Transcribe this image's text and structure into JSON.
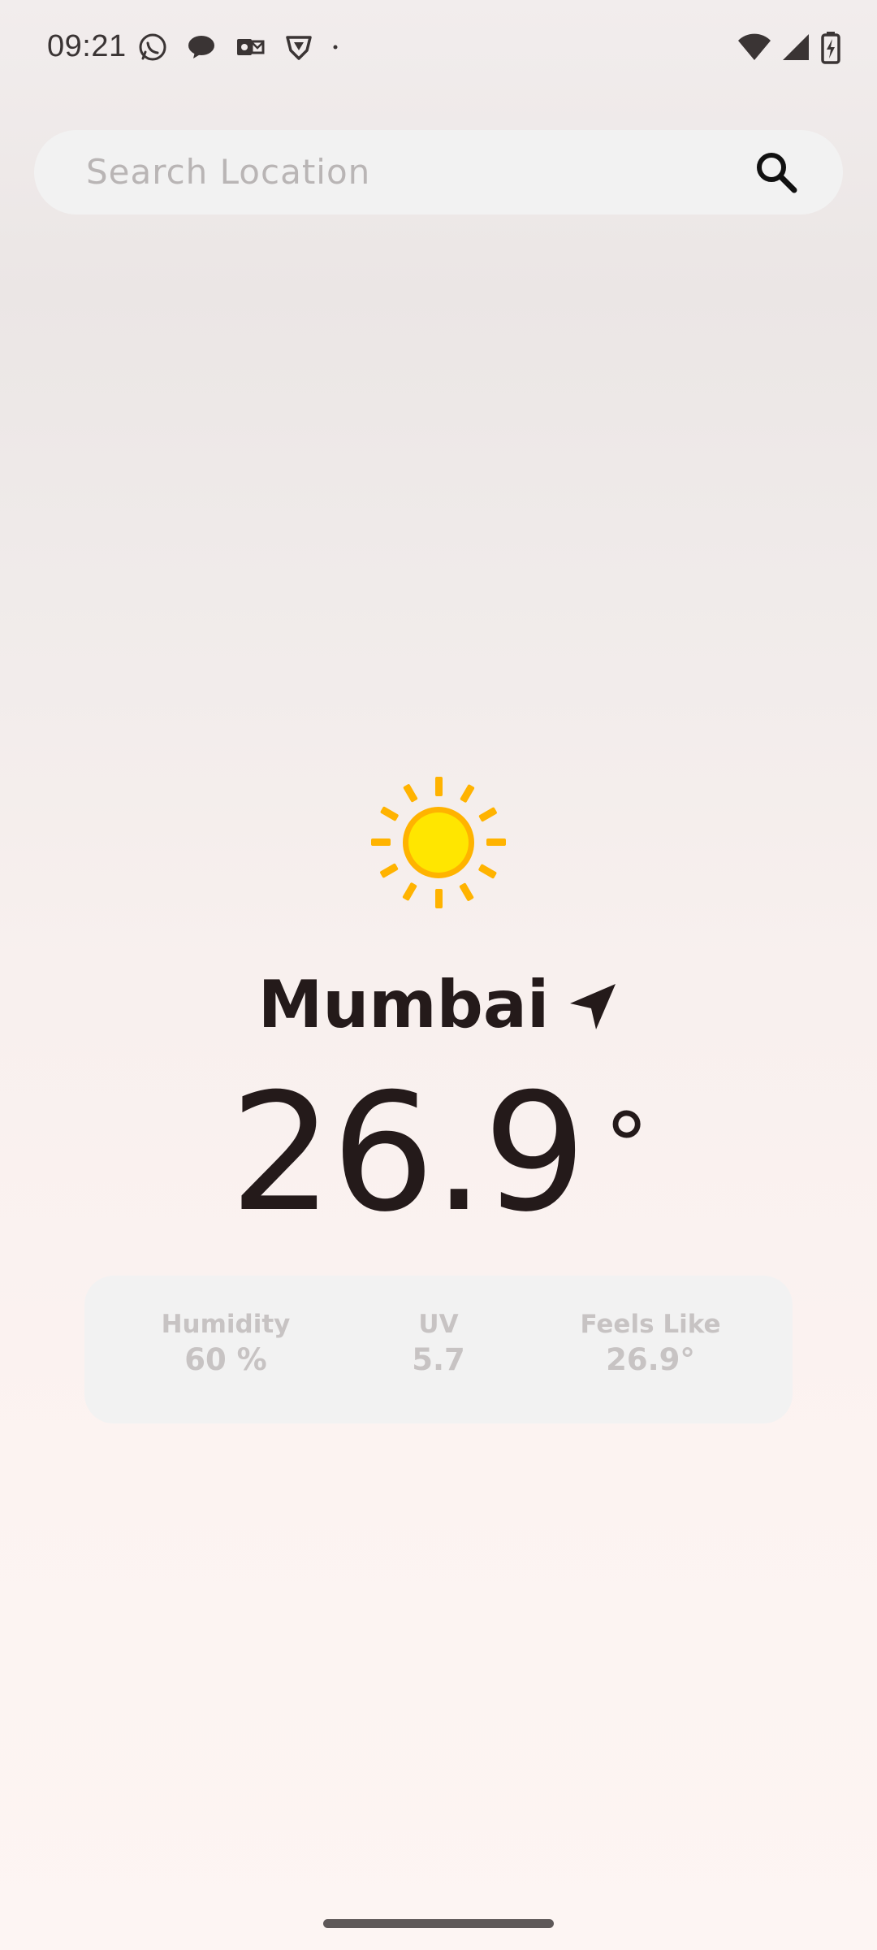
{
  "status_bar": {
    "time": "09:21",
    "notification_icons": [
      "whatsapp-icon",
      "chat-icon",
      "outlook-icon",
      "vpn-shield-icon",
      "dot-icon"
    ],
    "system_icons": [
      "wifi-icon",
      "signal-icon",
      "battery-charging-icon"
    ]
  },
  "search": {
    "placeholder": "Search Location",
    "icon": "search-icon"
  },
  "weather": {
    "condition_icon": "sun-icon",
    "city": "Mumbai",
    "location_icon": "navigation-arrow-icon",
    "temperature": "26.9",
    "temperature_unit": "°",
    "stats": {
      "humidity_label": "Humidity",
      "humidity_value": "60 %",
      "uv_label": "UV",
      "uv_value": "5.7",
      "feels_like_label": "Feels Like",
      "feels_like_value": "26.9°"
    }
  },
  "colors": {
    "text_primary": "#241a1a",
    "card_bg": "#f2f2f2",
    "sun_core": "#ffe600",
    "sun_rays": "#ffb300"
  }
}
